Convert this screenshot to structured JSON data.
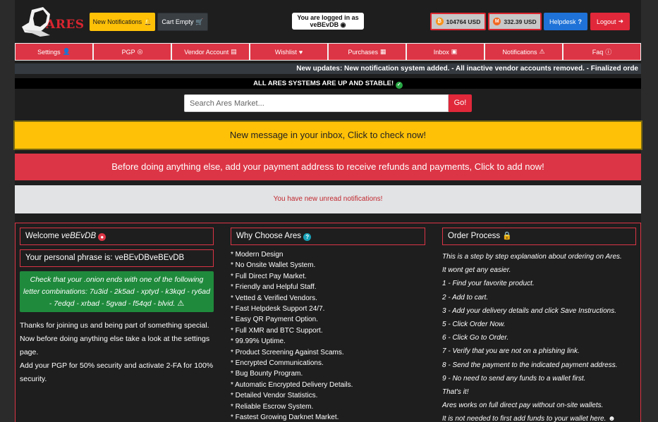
{
  "header": {
    "logo_text": "ARES",
    "notifications_label": "New Notifications",
    "cart_label": "Cart Empty",
    "logged_line1": "You are logged in as",
    "logged_user": "veBEvDB",
    "btc_balance": "104764 USD",
    "xmr_balance": "332.39 USD",
    "helpdesk_label": "Helpdesk",
    "logout_label": "Logout"
  },
  "nav": {
    "items": [
      {
        "label": "Settings",
        "icon": "user-gear-icon"
      },
      {
        "label": "PGP",
        "icon": "fingerprint-icon"
      },
      {
        "label": "Vendor Account",
        "icon": "id-card-icon"
      },
      {
        "label": "Wishlist",
        "icon": "heart-icon"
      },
      {
        "label": "Purchases",
        "icon": "cash-register-icon"
      },
      {
        "label": "Inbox",
        "icon": "inbox-icon"
      },
      {
        "label": "Notifications",
        "icon": "warning-icon"
      },
      {
        "label": "Faq",
        "icon": "info-icon"
      }
    ]
  },
  "ticker": "New updates: New notification system added. -  All inactive vendor accounts removed. -  Finalized orde",
  "status_text": "ALL ARES SYSTEMS ARE UP AND STABLE!",
  "search": {
    "placeholder": "Search Ares Market...",
    "button": "Go!"
  },
  "alerts": {
    "inbox": "New message in your inbox, Click to check now!",
    "payment": "Before doing anything else, add your payment address to receive refunds and payments, Click to add now!",
    "notifications": "You have new unread notifications!"
  },
  "welcome": {
    "prefix": "Welcome",
    "username": "veBEvDB",
    "phrase": "Your personal phrase is: veBEvDBveBEvDB",
    "onion_check": "Check that your .onion ends with one of the following letter combinations: 7u3id - 2k5ad - xptyd - k3kqd - ry6ad - 7edqd - xrbad - 5gvad - f54qd - blvid.",
    "text": [
      "Thanks for joining us and being part of something special. Now before doing anything else take a look at the settings page.",
      "Add your PGP for 50% security and activate 2-FA for 100% security."
    ]
  },
  "why": {
    "title": "Why Choose Ares",
    "items": [
      "* Modern Design",
      "* No Onsite Wallet System.",
      "* Full Direct Pay Market.",
      "* Friendly and Helpful Staff.",
      "* Vetted & Verified Vendors.",
      "* Fast Helpdesk Support 24/7.",
      "* Easy QR Payment Option.",
      "* Full XMR and BTC Support.",
      "* 99.99% Uptime.",
      "* Product Screening Against Scams.",
      "* Encrypted Communications.",
      "* Bug Bounty Program.",
      "* Automatic Encrypted Delivery Details.",
      "* Detailed Vendor Statistics.",
      "* Reliable Escrow System.",
      "* Fastest Growing Darknet Market."
    ]
  },
  "order": {
    "title": "Order Process",
    "steps": [
      "This is a step by step explanation about ordering on Ares.",
      "It wont get any easier.",
      "1 - Find your favorite product.",
      "2 - Add to cart.",
      "3 - Add your delivery details and click Save Instructions.",
      "5 - Click Order Now.",
      "6 - Click Go to Order.",
      "7 - Verify that you are not on a phishing link.",
      "8 - Send the payment to the indicated payment address.",
      "9 - No need to send any funds to a wallet first.",
      "That's it!",
      "Ares works on full direct pay without on-site wallets.",
      "It is not needed to first add funds to your wallet here."
    ]
  }
}
